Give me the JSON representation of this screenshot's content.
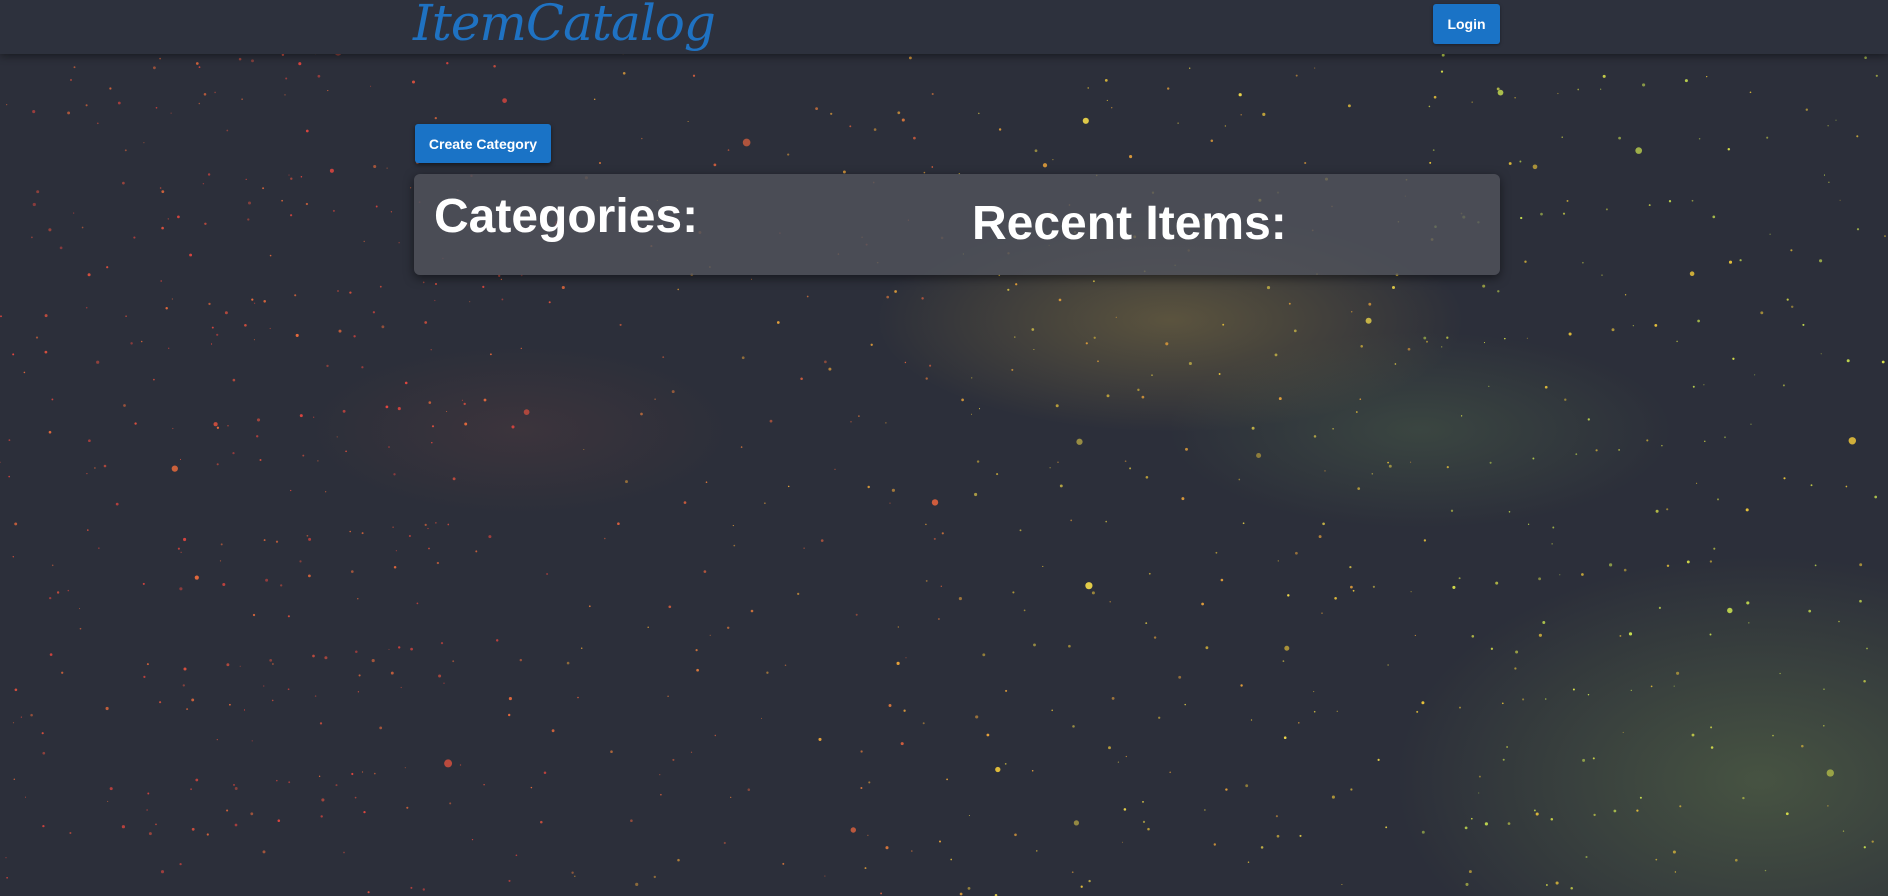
{
  "navbar": {
    "brand": "ItemCatalog",
    "login_label": "Login"
  },
  "toolbar": {
    "create_category_label": "Create Category"
  },
  "main": {
    "categories_heading": "Categories:",
    "recent_items_heading": "Recent Items:"
  },
  "colors": {
    "brand": "#1f72c2",
    "button": "#1a73c6",
    "navbar": "#2d313d",
    "background": "#2c2f3a"
  }
}
